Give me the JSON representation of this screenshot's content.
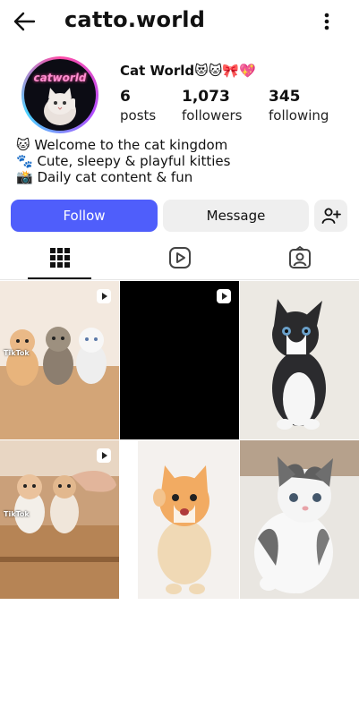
{
  "header": {
    "username": "catto.world"
  },
  "profile": {
    "display_name": "Cat World😻🐱🎀💖",
    "avatar_text": "catworld",
    "stats": [
      {
        "value": "6",
        "label": "posts"
      },
      {
        "value": "1,073",
        "label": "followers"
      },
      {
        "value": "345",
        "label": "following"
      }
    ],
    "bio": [
      "🐱 Welcome to the cat kingdom",
      "🐾 Cute, sleepy & playful kitties",
      "📸 Daily cat content & fun"
    ]
  },
  "actions": {
    "follow_label": "Follow",
    "message_label": "Message"
  },
  "tabs": [
    "grid-tab",
    "reels-tab",
    "tagged-tab"
  ],
  "posts": [
    {
      "kind": "reel",
      "watermark": "TikTok",
      "desc": "three kittens"
    },
    {
      "kind": "reel",
      "desc": "black video"
    },
    {
      "kind": "photo",
      "desc": "black and white kitten"
    },
    {
      "kind": "reel",
      "watermark": "TikTok",
      "desc": "two kittens on stairs"
    },
    {
      "kind": "photo",
      "desc": "orange kitten waving"
    },
    {
      "kind": "photo",
      "desc": "tabby white kitten"
    }
  ],
  "colors": {
    "accent": "#4f5efb",
    "secondary_btn": "#efefef"
  }
}
